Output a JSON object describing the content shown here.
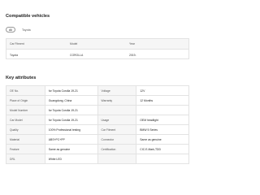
{
  "compatible": {
    "title": "Compatible vehicles",
    "tabs": [
      "All",
      "Toyota"
    ],
    "headers": [
      "Car Fitment",
      "Model",
      "Year"
    ],
    "rows": [
      [
        "Toyota",
        "COROLLA",
        "2019-"
      ]
    ]
  },
  "attributes": {
    "title": "Key attributes",
    "rows": [
      [
        {
          "k": "OE No.",
          "v": "for Toyota Corolla 19-21"
        },
        {
          "k": "Voltage",
          "v": "12V"
        }
      ],
      [
        {
          "k": "Place of Origin",
          "v": "Guangdong, China"
        },
        {
          "k": "Warranty",
          "v": "12 Months"
        }
      ],
      [
        {
          "k": "Model Number",
          "v": "for Toyota Corolla 19-21"
        },
        {
          "k": "",
          "v": ""
        }
      ],
      [
        {
          "k": "Car Model",
          "v": "for Toyota Corolla 19-21"
        },
        {
          "k": "Usage",
          "v": "OEM headlight"
        }
      ],
      [
        {
          "k": "Quality",
          "v": "100% Professional testing"
        },
        {
          "k": "Car Fitment",
          "v": "BMW 5 Series"
        }
      ],
      [
        {
          "k": "Material",
          "v": "ABS+PC+PP"
        },
        {
          "k": "Connector",
          "v": "Same as genuine"
        }
      ],
      [
        {
          "k": "Feature",
          "v": "Same as genuine"
        },
        {
          "k": "Certification",
          "v": "CIC.E-Mark,TDD"
        }
      ],
      [
        {
          "k": "DRL",
          "v": "White LED"
        },
        {
          "k": "",
          "v": ""
        }
      ]
    ]
  }
}
